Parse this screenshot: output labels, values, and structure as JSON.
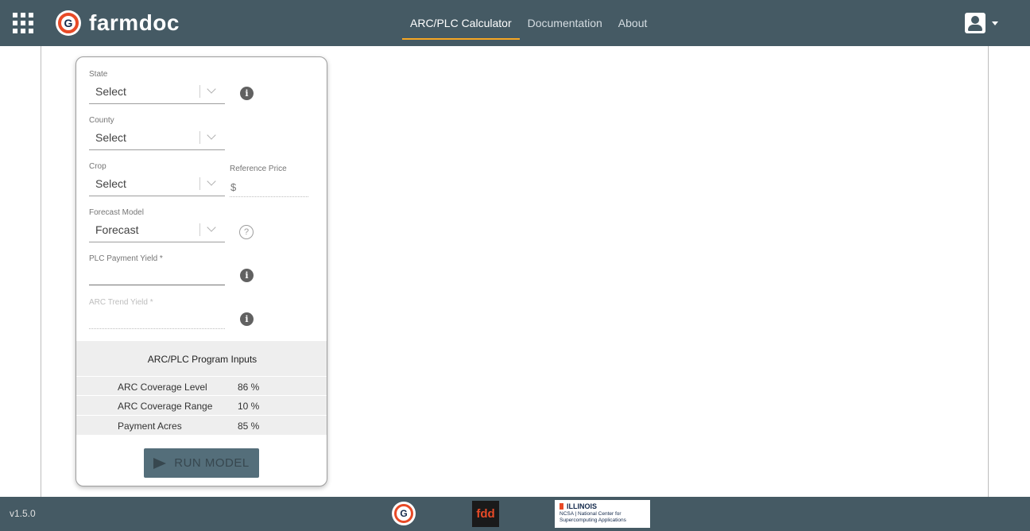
{
  "header": {
    "brand": "farmdoc",
    "logo_letter": "G",
    "nav": [
      {
        "label": "ARC/PLC Calculator",
        "active": true
      },
      {
        "label": "Documentation",
        "active": false
      },
      {
        "label": "About",
        "active": false
      }
    ]
  },
  "form": {
    "state": {
      "label": "State",
      "value": "Select"
    },
    "county": {
      "label": "County",
      "value": "Select"
    },
    "crop": {
      "label": "Crop",
      "value": "Select"
    },
    "reference_price": {
      "label": "Reference Price",
      "prefix": "$"
    },
    "forecast_model": {
      "label": "Forecast Model",
      "value": "Forecast"
    },
    "plc_payment_yield": {
      "label": "PLC Payment Yield *",
      "value": ""
    },
    "arc_trend_yield": {
      "label": "ARC Trend Yield *",
      "value": ""
    }
  },
  "program_inputs": {
    "title": "ARC/PLC Program Inputs",
    "rows": [
      {
        "label": "ARC Coverage Level",
        "value": "86 %"
      },
      {
        "label": "ARC Coverage Range",
        "value": "10 %"
      },
      {
        "label": "Payment Acres",
        "value": "85 %"
      }
    ]
  },
  "run_button": {
    "label": "RUN MODEL"
  },
  "footer": {
    "version": "v1.5.0",
    "logo_letter": "G",
    "fdd_label": "fdd",
    "ncsa_title": "ILLINOIS",
    "ncsa_subtitle_1": "NCSA | National Center for",
    "ncsa_subtitle_2": "Supercomputing Applications"
  },
  "colors": {
    "header_bg": "#455a64",
    "nav_active_underline": "#f5a623",
    "button_bg": "#546e7a",
    "illinois_orange": "#e84a27"
  }
}
